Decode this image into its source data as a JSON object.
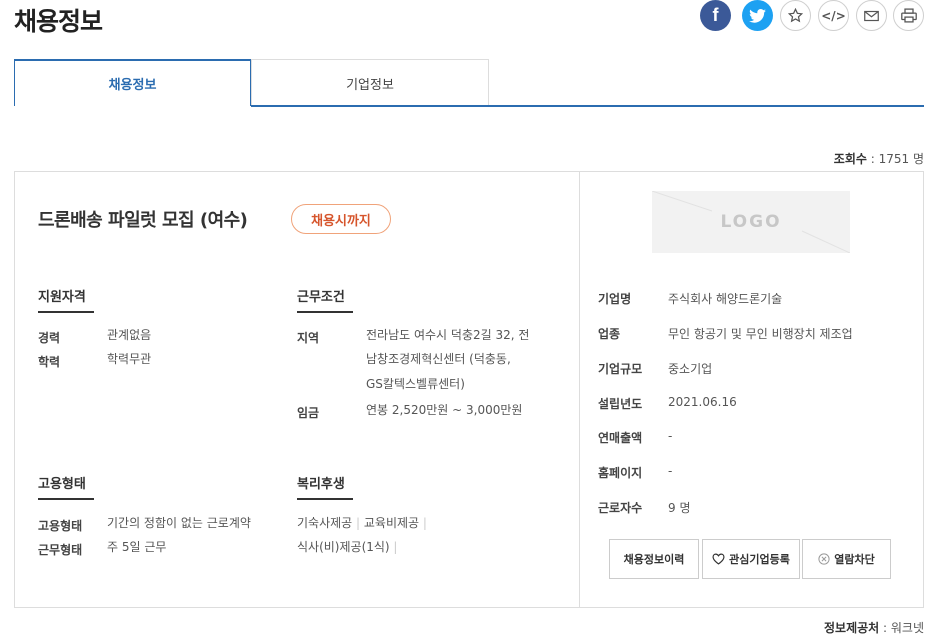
{
  "header": {
    "title": "채용정보"
  },
  "tabs": [
    {
      "label": "채용정보",
      "active": true
    },
    {
      "label": "기업정보",
      "active": false
    }
  ],
  "stats": {
    "views_label": "조회수",
    "views_value": "1751 명"
  },
  "job": {
    "title": "드론배송 파일럿 모집 (여수)",
    "deadline_badge": "채용시까지",
    "qualifications": {
      "heading": "지원자격",
      "rows": [
        {
          "label": "경력",
          "value": "관계없음"
        },
        {
          "label": "학력",
          "value": "학력무관"
        }
      ]
    },
    "conditions": {
      "heading": "근무조건",
      "region_label": "지역",
      "region_value": [
        "전라남도 여수시 덕충2길 32, 전",
        "남창조경제혁신센터 (덕충동,",
        "GS칼텍스벨류센터)"
      ],
      "salary_label": "임금",
      "salary_value": "연봉 2,520만원 ~ 3,000만원"
    },
    "employment": {
      "heading": "고용형태",
      "rows": [
        {
          "label": "고용형태",
          "value": "기간의 정함이 없는 근로계약"
        },
        {
          "label": "근무형태",
          "value": "주 5일 근무"
        }
      ]
    },
    "benefits": {
      "heading": "복리후생",
      "items": [
        "기숙사제공",
        "교육비제공",
        "식사(비)제공(1식)"
      ]
    }
  },
  "company": {
    "logo_text": "LOGO",
    "fields": [
      {
        "label": "기업명",
        "value": "주식회사 해양드론기술"
      },
      {
        "label": "업종",
        "value": "무인 항공기 및 무인 비행장치 제조업"
      },
      {
        "label": "기업규모",
        "value": "중소기업"
      },
      {
        "label": "설립년도",
        "value": "2021.06.16"
      },
      {
        "label": "연매출액",
        "value": "-"
      },
      {
        "label": "홈페이지",
        "value": "-"
      },
      {
        "label": "근로자수",
        "value": "9 명"
      }
    ],
    "buttons": {
      "history": "채용정보이력",
      "favorite": "관심기업등록",
      "block": "열람차단"
    }
  },
  "footer": {
    "source_label": "정보제공처",
    "source_value": "워크넷"
  },
  "colors": {
    "accent": "#2b6cb0",
    "badge": "#d6552c",
    "facebook": "#3b5998",
    "twitter": "#1da1f2"
  },
  "icons": [
    "facebook-icon",
    "twitter-icon",
    "star-icon",
    "embed-code-icon",
    "mail-icon",
    "print-icon",
    "heart-icon",
    "block-icon"
  ]
}
